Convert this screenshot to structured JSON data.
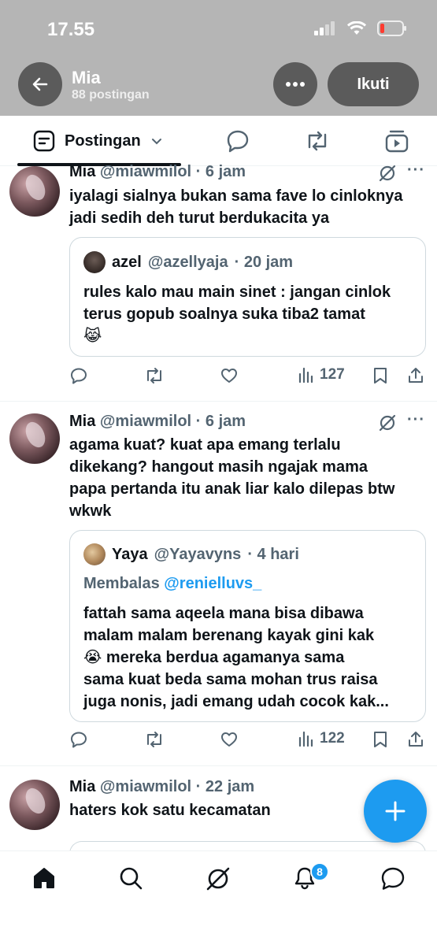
{
  "status": {
    "time": "17.55"
  },
  "header": {
    "name": "Mia",
    "post_count": "88 postingan",
    "follow_label": "Ikuti"
  },
  "tabs": {
    "active_label": "Postingan"
  },
  "posts": [
    {
      "name": "Mia",
      "handle": "@miawmilol",
      "time": "· 6 jam",
      "lines": [
        "iyalagi sialnya bukan sama fave lo cinloknya",
        "jadi sedih deh turut berdukacita ya"
      ],
      "quote": {
        "name": "azel",
        "handle": "@azellyaja",
        "time": "· 20 jam",
        "lines": [
          "rules kalo mau main sinet : jangan cinlok",
          "terus gopub soalnya suka tiba2 tamat",
          "😹"
        ]
      },
      "views": "127"
    },
    {
      "name": "Mia",
      "handle": "@miawmilol",
      "time": "· 6 jam",
      "lines": [
        "agama kuat? kuat apa emang terlalu",
        "dikekang? hangout masih ngajak mama",
        "papa pertanda itu anak liar kalo dilepas btw",
        "wkwk"
      ],
      "quote": {
        "name": "Yaya",
        "handle": "@Yayavyns",
        "time": "· 4 hari",
        "reply_prefix": "Membalas",
        "reply_to": "@renielluvs_",
        "lines": [
          "fattah sama aqeela mana bisa dibawa",
          "malam malam berenang kayak gini kak",
          "😭 mereka berdua agamanya sama",
          "sama kuat beda sama mohan trus raisa",
          "juga nonis, jadi emang udah cocok kak..."
        ]
      },
      "views": "122"
    },
    {
      "name": "Mia",
      "handle": "@miawmilol",
      "time": "· 22 jam",
      "lines": [
        "haters kok satu kecamatan"
      ]
    }
  ],
  "nav": {
    "notification_count": "8"
  },
  "colors": {
    "accent": "#1d9bf0",
    "muted": "#536471",
    "header_bg": "#b5b5b5"
  }
}
